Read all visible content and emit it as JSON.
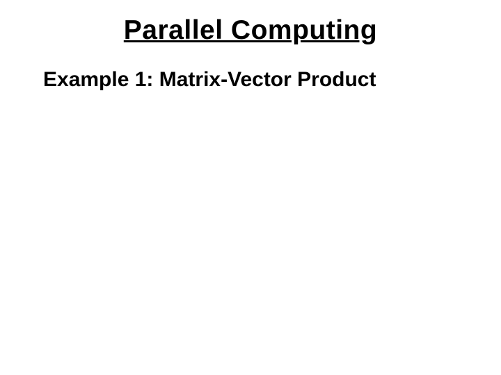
{
  "slide": {
    "title": "Parallel Computing",
    "subtitle": "Example 1: Matrix-Vector Product"
  }
}
